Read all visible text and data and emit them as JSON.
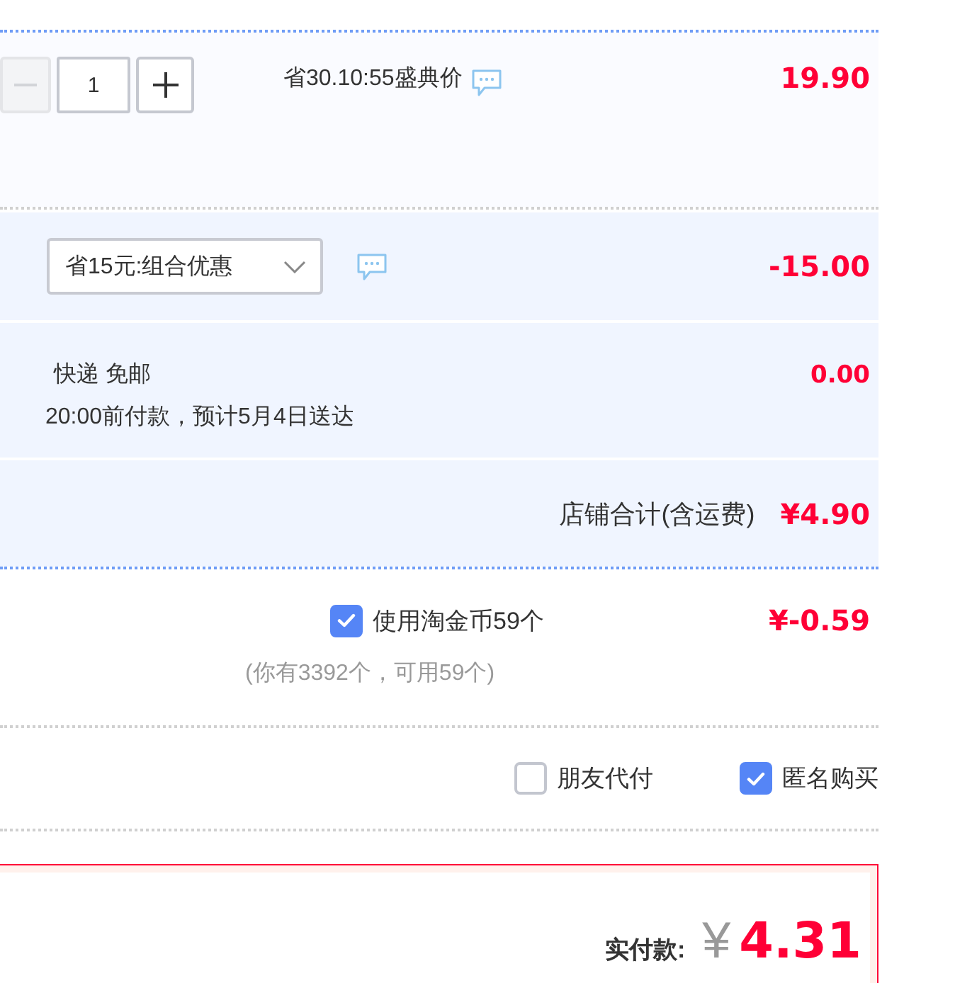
{
  "item": {
    "stepper": {
      "decrease_disabled": true,
      "quantity": "1"
    },
    "promo_label": "省30.10:55盛典价",
    "price": "19.90"
  },
  "discount": {
    "option": "省15元:组合优惠",
    "amount": "-15.00"
  },
  "shipping": {
    "method": "快递 免邮",
    "delivery_note": "20:00前付款，预计5月4日送达",
    "fee": "0.00"
  },
  "store_total": {
    "label": "店铺合计(含运费)",
    "amount": "¥4.90"
  },
  "coins": {
    "checked": true,
    "label": "使用淘金币59个",
    "note": "(你有3392个，可用59个)",
    "amount": "¥-0.59"
  },
  "options": [
    {
      "label": "朋友代付",
      "checked": false
    },
    {
      "label": "匿名购买",
      "checked": true
    }
  ],
  "payment": {
    "label": "实付款:",
    "currency": "¥",
    "amount": "4.31"
  }
}
